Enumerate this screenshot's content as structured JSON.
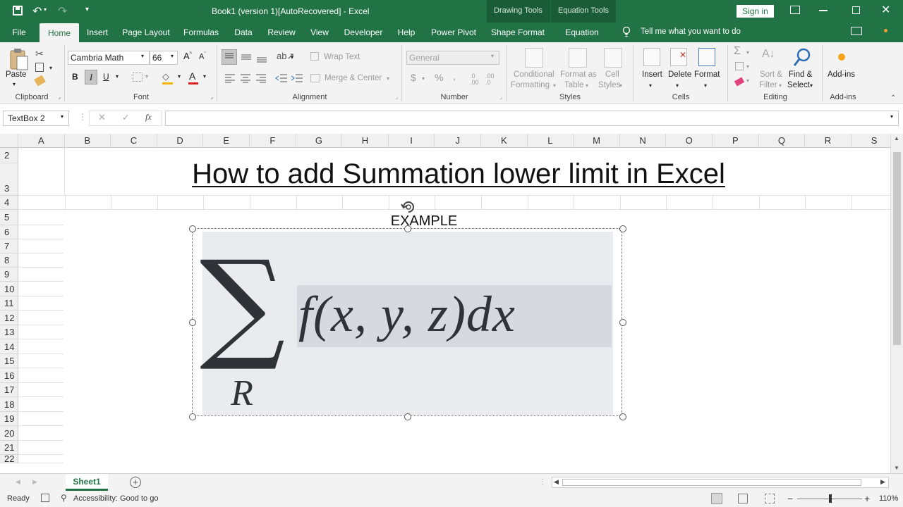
{
  "window": {
    "title": "Book1 (version 1)[AutoRecovered]  -  Excel",
    "context_tabs": [
      "Drawing Tools",
      "Equation Tools"
    ],
    "sign_in": "Sign in"
  },
  "tabs": [
    {
      "label": "File"
    },
    {
      "label": "Home"
    },
    {
      "label": "Insert"
    },
    {
      "label": "Page Layout"
    },
    {
      "label": "Formulas"
    },
    {
      "label": "Data"
    },
    {
      "label": "Review"
    },
    {
      "label": "View"
    },
    {
      "label": "Developer"
    },
    {
      "label": "Help"
    },
    {
      "label": "Power Pivot"
    },
    {
      "label": "Shape Format"
    },
    {
      "label": "Equation"
    }
  ],
  "tell_me": "Tell me what you want to do",
  "ribbon": {
    "clipboard": {
      "paste": "Paste",
      "label": "Clipboard"
    },
    "font": {
      "name": "Cambria Math",
      "size": "66",
      "bold": "B",
      "italic": "I",
      "underline": "U",
      "label": "Font"
    },
    "alignment": {
      "wrap": "Wrap Text",
      "merge": "Merge & Center",
      "label": "Alignment"
    },
    "number": {
      "format": "General",
      "currency": "$",
      "percent": "%",
      "comma": ",",
      "label": "Number"
    },
    "styles": {
      "cond1": "Conditional",
      "cond2": "Formatting",
      "fmt1": "Format as",
      "fmt2": "Table",
      "cell1": "Cell",
      "cell2": "Styles",
      "label": "Styles"
    },
    "cells": {
      "insert": "Insert",
      "delete": "Delete",
      "format": "Format",
      "label": "Cells"
    },
    "editing": {
      "sort1": "Sort &",
      "sort2": "Filter",
      "find1": "Find &",
      "find2": "Select",
      "label": "Editing"
    },
    "addins": {
      "addins": "Add-ins",
      "label": "Add-ins"
    }
  },
  "formula_bar": {
    "name_box": "TextBox 2",
    "fx": "fx",
    "value": ""
  },
  "columns": [
    "A",
    "B",
    "C",
    "D",
    "E",
    "F",
    "G",
    "H",
    "I",
    "J",
    "K",
    "L",
    "M",
    "N",
    "O",
    "P",
    "Q",
    "R",
    "S"
  ],
  "rows": [
    "2",
    "3",
    "4",
    "5",
    "6",
    "7",
    "8",
    "9",
    "10",
    "11",
    "12",
    "13",
    "14",
    "15",
    "16",
    "17",
    "18",
    "19",
    "20",
    "21",
    "22"
  ],
  "sheet": {
    "heading": "How to add Summation lower  limit in Excel",
    "example": "EXAMPLE",
    "equation": {
      "operator": "∑",
      "lower_limit": "R",
      "body": "f(x, y, z)dx"
    }
  },
  "sheet_tabs": [
    {
      "label": "Sheet1"
    }
  ],
  "status": {
    "ready": "Ready",
    "accessibility": "Accessibility: Good to go",
    "zoom": "110%"
  },
  "colors": {
    "excel_green": "#217346",
    "ribbon_bg": "#f3f3f3"
  }
}
